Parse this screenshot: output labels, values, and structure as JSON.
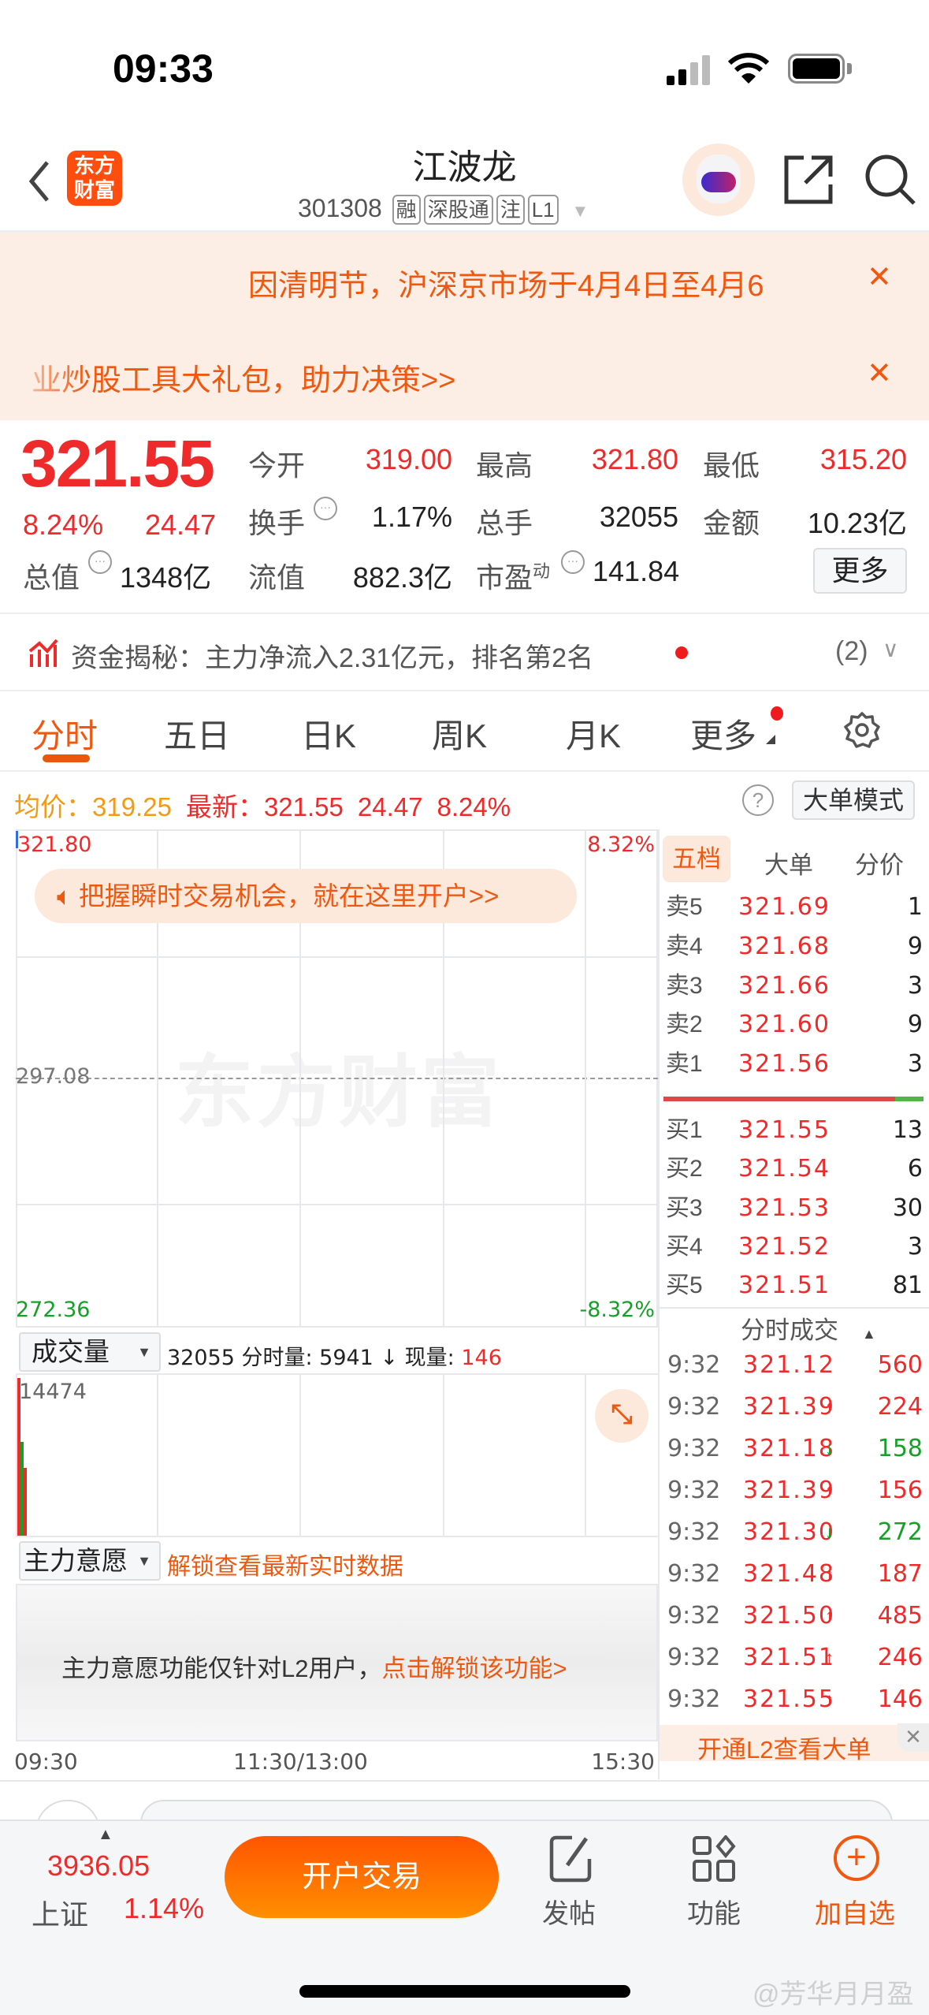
{
  "status_bar": {
    "time": "09:33"
  },
  "header": {
    "logo_text": "东方财富",
    "title": "江波龙",
    "code": "301308",
    "tags": [
      "融",
      "深股通",
      "注",
      "L1"
    ]
  },
  "banners": [
    {
      "text": "因清明节，沪深京市场于4月4日至4月6",
      "close": "✕"
    },
    {
      "text": "业炒股工具大礼包，助力决策>>",
      "close": "✕"
    }
  ],
  "quote": {
    "price": "321.55",
    "change_pct": "8.24%",
    "change": "24.47",
    "open_label": "今开",
    "open": "319.00",
    "high_label": "最高",
    "high": "321.80",
    "low_label": "最低",
    "low": "315.20",
    "turnover_label": "换手",
    "turnover": "1.17%",
    "volume_label": "总手",
    "volume": "32055",
    "amount_label": "金额",
    "amount": "10.23亿",
    "mktcap_label": "总值",
    "mktcap": "1348亿",
    "float_label": "流值",
    "float_cap": "882.3亿",
    "pe_label": "市盈",
    "pe_sup": "动",
    "pe": "141.84",
    "more_button": "更多"
  },
  "fund_flow": {
    "text": "资金揭秘：主力净流入2.31亿元，排名第2名",
    "count": "(2)"
  },
  "tabs": [
    {
      "label": "分时",
      "active": true
    },
    {
      "label": "五日"
    },
    {
      "label": "日K"
    },
    {
      "label": "周K"
    },
    {
      "label": "月K"
    },
    {
      "label": "更多"
    }
  ],
  "info_line": {
    "avg_label": "均价：",
    "avg": "319.25",
    "latest_label": "最新：",
    "latest": "321.55",
    "change": "24.47",
    "change_pct": "8.24%",
    "help": "?",
    "big_order_button": "大单模式"
  },
  "chart": {
    "y_top": "321.80",
    "y_mid": "297.08",
    "y_bottom": "272.36",
    "pct_top": "8.32%",
    "pct_bottom": "-8.32%",
    "ad_text": "把握瞬时交易机会，就在这里开户>>",
    "watermark": "东方财富",
    "volume_selector": "成交量",
    "volume_info": "32055 分时量: 5941 ↓ 现量: ",
    "volume_now": "146",
    "volume_max": "14474",
    "volume_bars": [
      {
        "value": 14474,
        "color": "red"
      },
      {
        "value": 8600,
        "color": "green"
      },
      {
        "value": 6200,
        "color": "red"
      }
    ],
    "main_force_selector": "主力意愿",
    "unlock_text": "解锁查看最新实时数据",
    "l2_text": "主力意愿功能仅针对L2用户，",
    "l2_link": "点击解锁该功能>",
    "time_labels": [
      "09:30",
      "11:30/13:00",
      "15:30"
    ]
  },
  "order_book": {
    "tabs": [
      "五档",
      "大单",
      "分价"
    ],
    "asks": [
      {
        "label": "卖5",
        "price": "321.69",
        "qty": "1"
      },
      {
        "label": "卖4",
        "price": "321.68",
        "qty": "9"
      },
      {
        "label": "卖3",
        "price": "321.66",
        "qty": "3"
      },
      {
        "label": "卖2",
        "price": "321.60",
        "qty": "9"
      },
      {
        "label": "卖1",
        "price": "321.56",
        "qty": "3"
      }
    ],
    "bid_ratio": 0.89,
    "bids": [
      {
        "label": "买1",
        "price": "321.55",
        "qty": "13"
      },
      {
        "label": "买2",
        "price": "321.54",
        "qty": "6"
      },
      {
        "label": "买3",
        "price": "321.53",
        "qty": "30"
      },
      {
        "label": "买4",
        "price": "321.52",
        "qty": "3"
      },
      {
        "label": "买5",
        "price": "321.51",
        "qty": "81"
      }
    ]
  },
  "trades": {
    "title": "分时成交",
    "rows": [
      {
        "time": "9:32",
        "price": "321.12",
        "arrow": "",
        "vol": "560",
        "dir": "up"
      },
      {
        "time": "9:32",
        "price": "321.39",
        "arrow": "↑",
        "vol": "224",
        "dir": "up"
      },
      {
        "time": "9:32",
        "price": "321.18",
        "arrow": "↓",
        "vol": "158",
        "dir": "down"
      },
      {
        "time": "9:32",
        "price": "321.39",
        "arrow": "↑",
        "vol": "156",
        "dir": "up"
      },
      {
        "time": "9:32",
        "price": "321.30",
        "arrow": "↓",
        "vol": "272",
        "dir": "down"
      },
      {
        "time": "9:32",
        "price": "321.48",
        "arrow": "↑",
        "vol": "187",
        "dir": "up"
      },
      {
        "time": "9:32",
        "price": "321.50",
        "arrow": "↑",
        "vol": "485",
        "dir": "up"
      },
      {
        "time": "9:32",
        "price": "321.51",
        "arrow": "↑",
        "vol": "246",
        "dir": "up"
      },
      {
        "time": "9:32",
        "price": "321.55",
        "arrow": "↑",
        "vol": "146",
        "dir": "up"
      }
    ],
    "l2_promo": "开通L2查看大单"
  },
  "bottom_bar": {
    "index_value": "3936.05",
    "index_name": "上证",
    "index_pct": "1.14%",
    "trade_button": "开户交易",
    "post": "发帖",
    "functions": "功能",
    "add_watch": "加自选"
  },
  "watermark": "@芳华月月盈"
}
